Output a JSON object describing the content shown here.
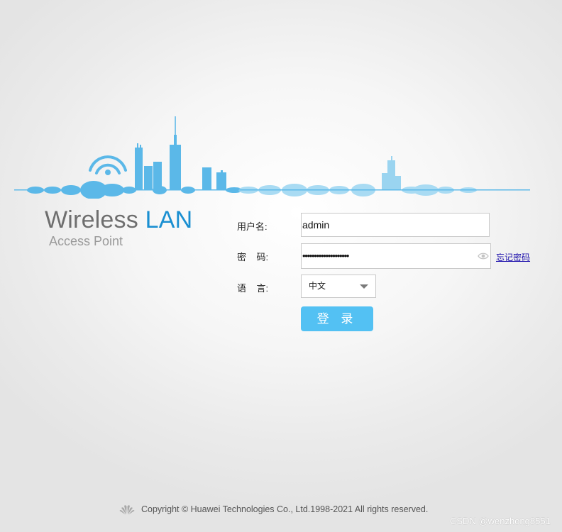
{
  "brand": {
    "title_part1": "Wireless ",
    "title_part2": "LAN",
    "subtitle": "Access Point"
  },
  "form": {
    "username_label": "用户名:",
    "username_value": "admin",
    "password_label": "密    码:",
    "password_mask": "••••••••••••••••••••",
    "forgot_link": "忘记密码",
    "language_label": "语    言:",
    "language_value": "中文",
    "login_button": "登 录"
  },
  "footer": {
    "copyright": "Copyright © Huawei Technologies Co., Ltd.1998-2021 All rights reserved."
  },
  "watermark": "CSDN @wenzhong8551",
  "colors": {
    "accent": "#53c1f3",
    "brand_blue": "#1a8fd1",
    "skyline_blue": "#5bb8e8"
  },
  "icons": {
    "wifi": "wifi-icon",
    "eye": "eye-icon",
    "logo": "huawei-logo-icon",
    "caret": "chevron-down-icon"
  }
}
